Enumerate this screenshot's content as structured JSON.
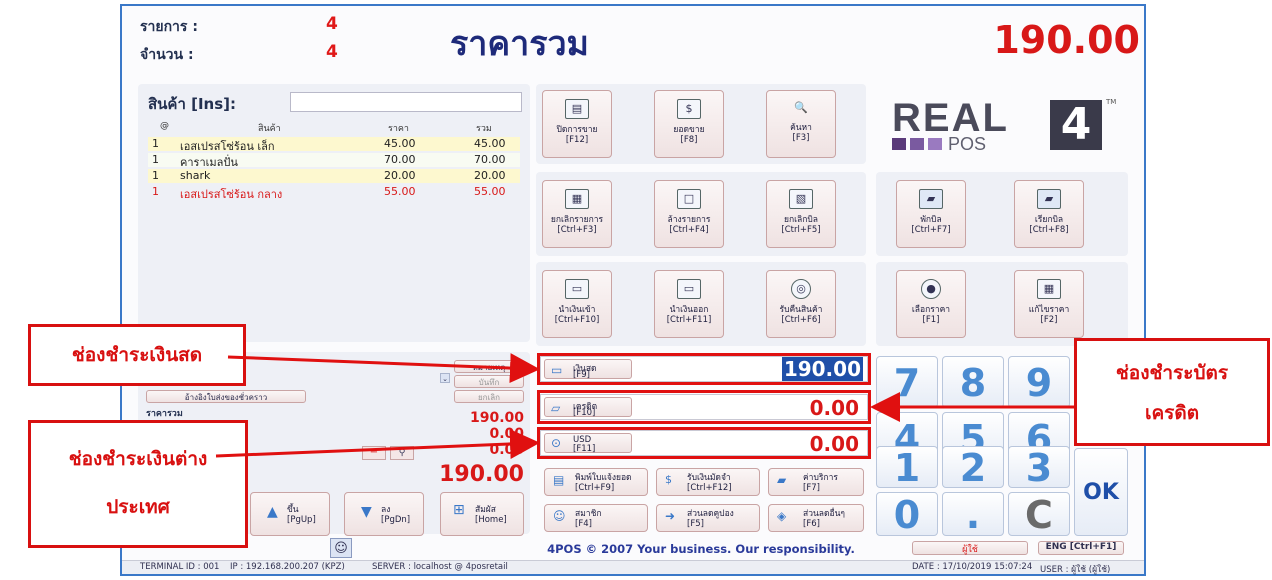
{
  "header": {
    "items_label": "รายการ :",
    "items_value": "4",
    "qty_label": "จำนวน :",
    "qty_value": "4",
    "title": "ราคารวม",
    "total": "190.00"
  },
  "product": {
    "label": "สินค้า [Ins]:",
    "input_value": "",
    "columns": [
      "@",
      "สินค้า",
      "ราคา",
      "รวม"
    ],
    "rows": [
      {
        "qty": "1",
        "name": "เอสเปรสโซ่ร้อน เล็ก",
        "price": "45.00",
        "total": "45.00"
      },
      {
        "qty": "1",
        "name": "คาราเมลปั่น",
        "price": "70.00",
        "total": "70.00"
      },
      {
        "qty": "1",
        "name": "shark",
        "price": "20.00",
        "total": "20.00"
      },
      {
        "qty": "1",
        "name": "เอสเปรสโซ่ร้อน กลาง",
        "price": "55.00",
        "total": "55.00"
      }
    ]
  },
  "function_buttons": [
    {
      "label": "ปิดการขาย",
      "key": "[F12]",
      "icon": "document-icon"
    },
    {
      "label": "ยอดขาย",
      "key": "[F8]",
      "icon": "dollar-icon"
    },
    {
      "label": "ค้นหา",
      "key": "[F3]",
      "icon": "search-icon"
    },
    {
      "label": "ยกเลิกรายการ",
      "key": "[Ctrl+F3]",
      "icon": "cancel-item-icon"
    },
    {
      "label": "ล้างรายการ",
      "key": "[Ctrl+F4]",
      "icon": "clear-icon"
    },
    {
      "label": "ยกเลิกบิล",
      "key": "[Ctrl+F5]",
      "icon": "cancel-bill-icon"
    },
    {
      "label": "พักบิล",
      "key": "[Ctrl+F7]",
      "icon": "folder-icon"
    },
    {
      "label": "เรียกบิล",
      "key": "[Ctrl+F8]",
      "icon": "folder-open-icon"
    },
    {
      "label": "นำเงินเข้า",
      "key": "[Ctrl+F10]",
      "icon": "cash-in-icon"
    },
    {
      "label": "นำเงินออก",
      "key": "[Ctrl+F11]",
      "icon": "cash-out-icon"
    },
    {
      "label": "รับคืนสินค้า",
      "key": "[Ctrl+F6]",
      "icon": "return-icon"
    },
    {
      "label": "เลือกราคา",
      "key": "[F1]",
      "icon": "price-icon"
    },
    {
      "label": "แก้ไขราคา",
      "key": "[F2]",
      "icon": "calculator-icon"
    }
  ],
  "logo": {
    "text": "REAL",
    "sub": "POS",
    "num": "4",
    "tm": "TM"
  },
  "left_lower": {
    "member_btn": "หมายเหตุ",
    "save_btn": "บันทึก",
    "cancel_btn": "ยกเลิก",
    "ref_btn": "อ้างอิงใบส่งของชั่วคราว",
    "summary_label": "ราคารวม",
    "v1": "190.00",
    "v2": "0.00",
    "v3": "0.00",
    "big_total": "190.00",
    "nav_up": "ขึ้น",
    "nav_up_key": "[PgUp]",
    "nav_down": "ลง",
    "nav_down_key": "[PgDn]",
    "nav_home": "สัมผัส",
    "nav_home_key": "[Home]"
  },
  "payments": [
    {
      "label": "เงินสด",
      "key": "[F9]",
      "value": "190.00"
    },
    {
      "label": "เครดิต",
      "key": "[F10]",
      "value": "0.00"
    },
    {
      "label": "USD",
      "key": "[F11]",
      "value": "0.00"
    }
  ],
  "bottom_buttons": [
    {
      "label": "พิมพ์ใบแจ้งยอด",
      "key": "[Ctrl+F9]"
    },
    {
      "label": "รับเงินมัดจำ",
      "key": "[Ctrl+F12]"
    },
    {
      "label": "ค่าบริการ",
      "key": "[F7]"
    },
    {
      "label": "สมาชิก",
      "key": "[F4]"
    },
    {
      "label": "ส่วนลดคูปอง",
      "key": "[F5]"
    },
    {
      "label": "ส่วนลดอื่นๆ",
      "key": "[F6]"
    }
  ],
  "keypad": [
    "7",
    "8",
    "9",
    "4",
    "5",
    "6",
    "1",
    "2",
    "3",
    "0",
    ".",
    "C"
  ],
  "ok_label": "OK",
  "footer": {
    "slogan": "4POS © 2007 Your business. Our responsibility.",
    "user_btn": "ผู้ใช้",
    "lang_btn": "ENG [Ctrl+F1]"
  },
  "status": {
    "terminal": "TERMINAL ID : 001",
    "ip": "IP : 192.168.200.207 (KPZ)",
    "server": "SERVER : localhost @ 4posretail",
    "date": "DATE : 17/10/2019 15:07:24",
    "user": "USER : ผู้ใช้ (ผู้ใช้)"
  },
  "callouts": {
    "cash": "ช่องชำระเงินสด",
    "credit_line1": "ช่องชำระบัตร",
    "credit_line2": "เครดิต",
    "foreign_line1": "ช่องชำระเงินต่าง",
    "foreign_line2": "ประเทศ"
  },
  "colors": {
    "accent": "#d81818",
    "title": "#1e2a7a",
    "key": "#4a8bd1",
    "callout": "#d81010"
  }
}
